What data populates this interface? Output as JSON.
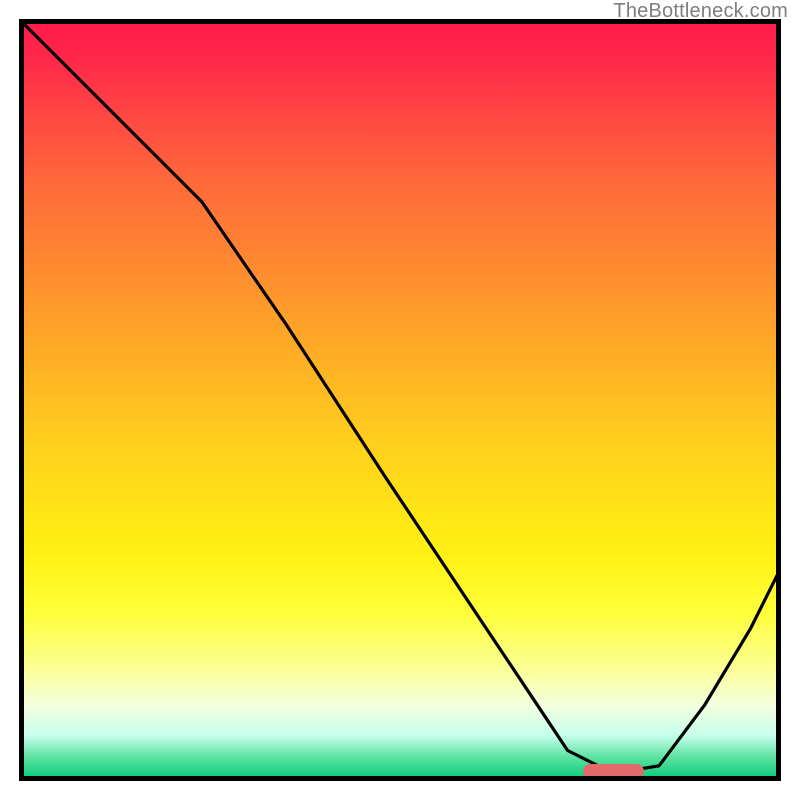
{
  "watermark": "TheBottleneck.com",
  "chart_data": {
    "type": "line",
    "title": "",
    "xlabel": "",
    "ylabel": "",
    "xlim": [
      0,
      100
    ],
    "ylim": [
      0,
      100
    ],
    "background": "rainbow-gradient-red-to-green",
    "series": [
      {
        "name": "curve",
        "x": [
          0,
          8,
          16,
          24,
          35,
          48,
          60,
          68,
          72,
          78,
          84,
          90,
          96,
          100
        ],
        "y": [
          100,
          92,
          84,
          76,
          60,
          40,
          22,
          10,
          4,
          1,
          2,
          10,
          20,
          28
        ]
      }
    ],
    "marker": {
      "name": "highlight-bar",
      "x_center_pct": 78,
      "width_pct": 8,
      "y_pct": 1.2,
      "color": "#e26a6a"
    }
  }
}
